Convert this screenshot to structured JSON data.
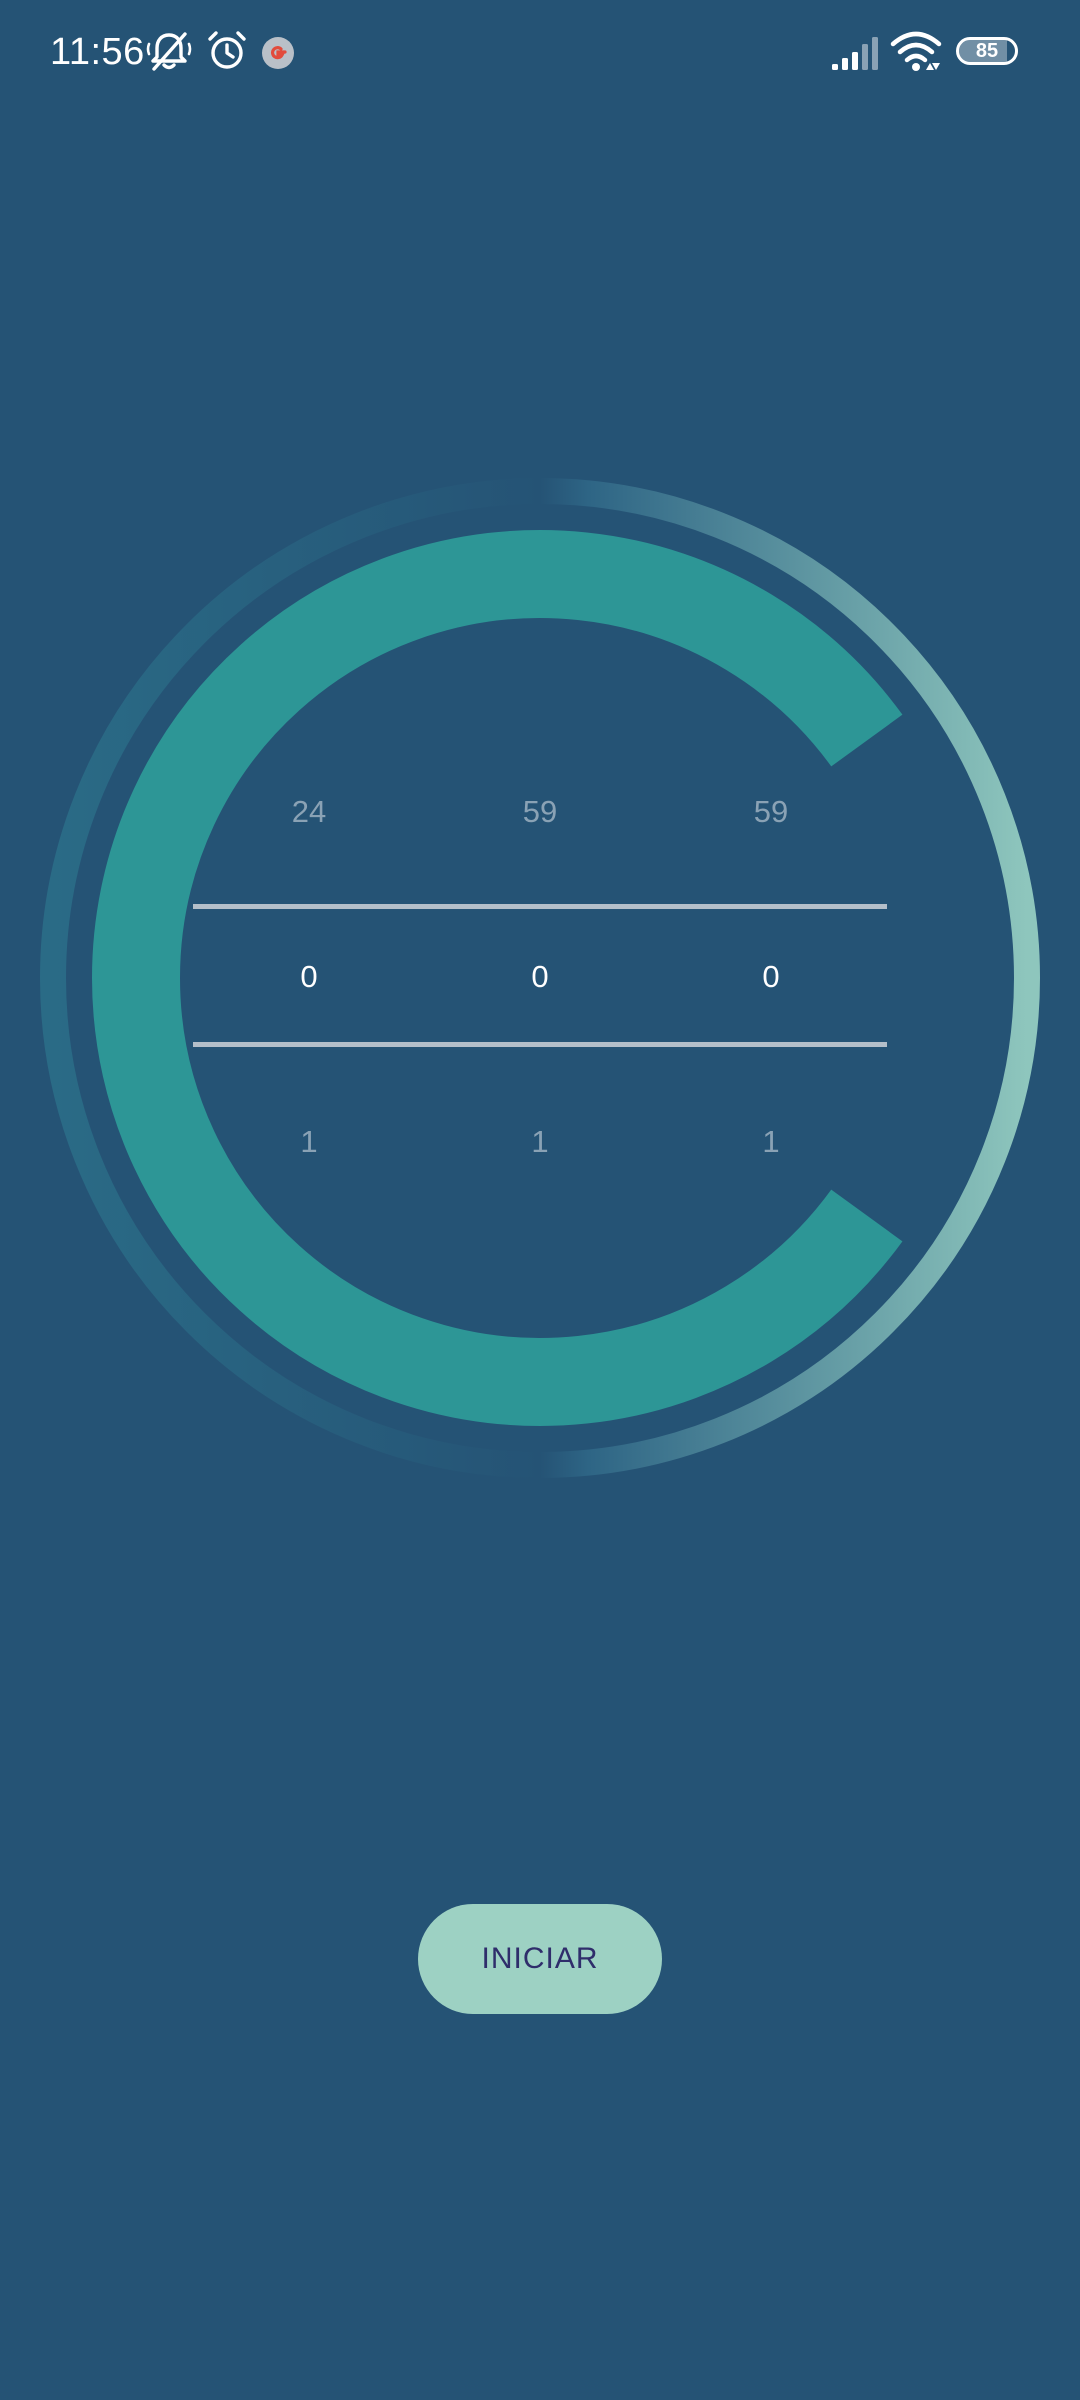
{
  "status_bar": {
    "time": "11:56",
    "battery_level": "85",
    "icons": [
      "muted-bell-icon",
      "alarm-icon",
      "google-icon",
      "signal-icon",
      "wifi-icon",
      "battery-icon"
    ]
  },
  "dial": {
    "progress_fraction": 0.8,
    "colors": {
      "progress": "#2d9696",
      "ring_start": "#2a6b86",
      "ring_end": "#8ec6bd",
      "background": "#255375"
    }
  },
  "picker": {
    "hours": {
      "prev": "24",
      "current": "0",
      "next": "1"
    },
    "minutes": {
      "prev": "59",
      "current": "0",
      "next": "1"
    },
    "seconds": {
      "prev": "59",
      "current": "0",
      "next": "1"
    }
  },
  "start_button": {
    "label": "INICIAR",
    "background": "#9dd1c3",
    "text_color": "#2f2d6b"
  }
}
